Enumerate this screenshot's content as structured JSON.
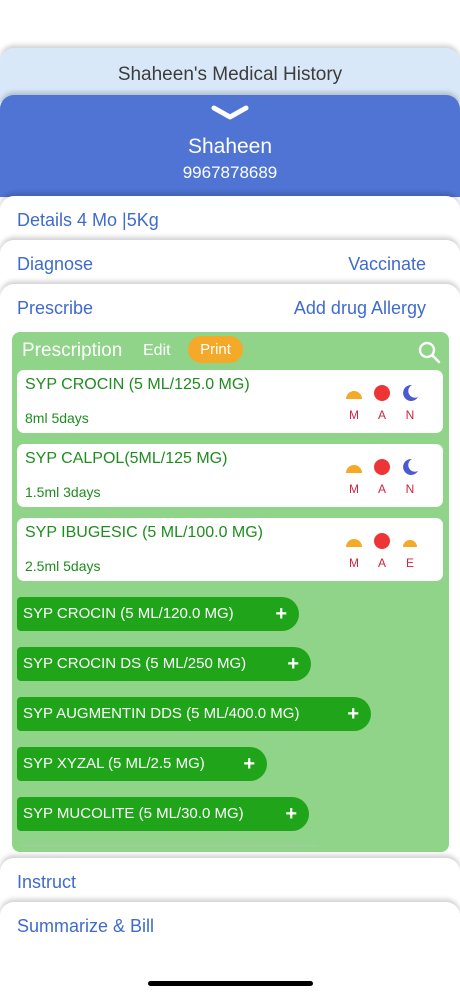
{
  "header": {
    "title": "Shaheen's Medical History"
  },
  "patient": {
    "name": "Shaheen",
    "phone": "9967878689"
  },
  "rows": {
    "details": "Details 4 Mo |5Kg",
    "diagnose": "Diagnose",
    "vaccinate": "Vaccinate",
    "prescribe": "Prescribe",
    "add_allergy": "Add drug Allergy",
    "instruct": "Instruct",
    "summarize": "Summarize & Bill"
  },
  "prescription": {
    "title": "Prescription",
    "edit_label": "Edit",
    "print_label": "Print",
    "medicines": [
      {
        "name": "SYP CROCIN (5 ML/125.0 MG)",
        "dose": "8ml  5days",
        "slots": [
          "M",
          "A",
          "N"
        ]
      },
      {
        "name": "SYP CALPOL(5ML/125 MG)",
        "dose": "1.5ml  3days",
        "slots": [
          "M",
          "A",
          "N"
        ]
      },
      {
        "name": "SYP IBUGESIC (5 ML/100.0 MG)",
        "dose": "2.5ml  5days",
        "slots": [
          "M",
          "A",
          "E"
        ]
      }
    ],
    "suggestions": [
      "SYP CROCIN (5 ML/120.0 MG)",
      "SYP CROCIN DS (5 ML/250 MG)",
      "SYP AUGMENTIN DDS (5 ML/400.0 MG)",
      "SYP XYZAL (5 ML/2.5 MG)",
      "SYP MUCOLITE (5 ML/30.0 MG)"
    ],
    "plus": "+"
  },
  "colors": {
    "title_bg": "#d9e8f8",
    "patient_bg": "#4f74d4",
    "link": "#3f6bcc",
    "panel_bg": "#8fd488",
    "pill_bg": "#20a51a",
    "print_bg": "#f4a928"
  }
}
